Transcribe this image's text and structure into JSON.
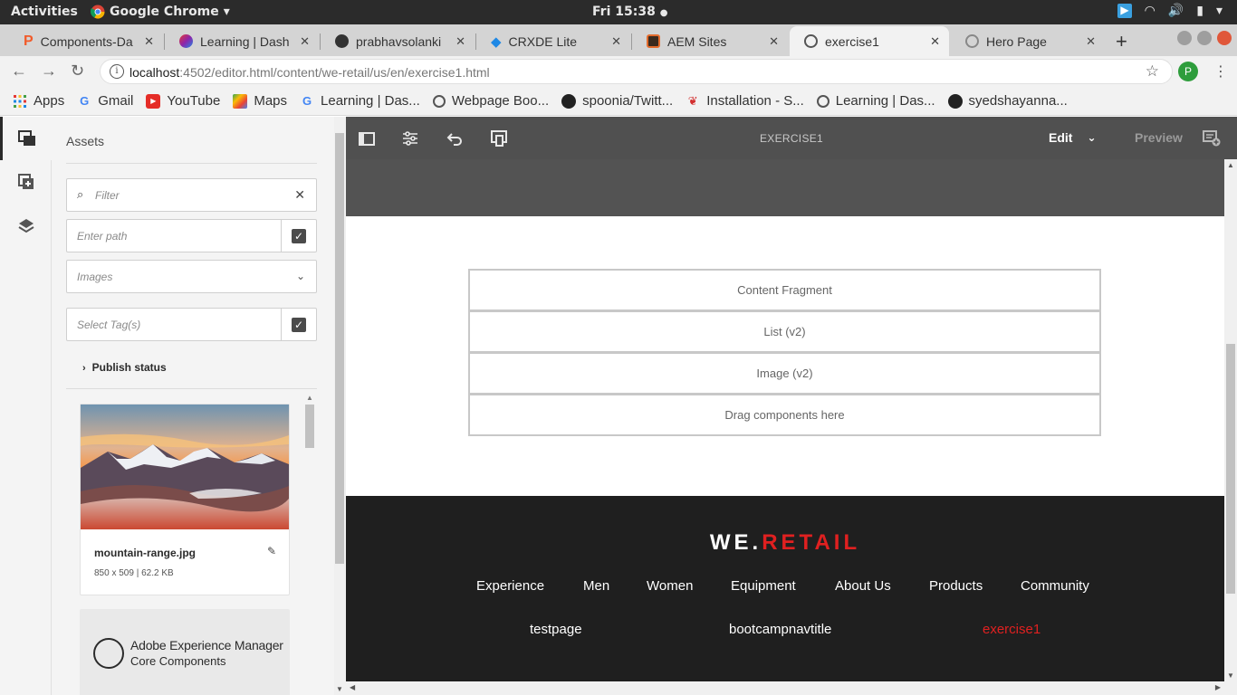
{
  "os": {
    "activities": "Activities",
    "app_name": "Google Chrome",
    "clock": "Fri 15:38"
  },
  "browser": {
    "tabs": [
      {
        "title": "Components-Da",
        "icon": "pluralsight-icon"
      },
      {
        "title": "Learning | Dash",
        "icon": "learning-icon"
      },
      {
        "title": "prabhavsolanki",
        "icon": "github-icon"
      },
      {
        "title": "CRXDE Lite",
        "icon": "crxde-icon"
      },
      {
        "title": "AEM Sites",
        "icon": "aem-icon"
      },
      {
        "title": "exercise1",
        "icon": "globe-icon",
        "active": true
      },
      {
        "title": "Hero Page",
        "icon": "globe-icon"
      }
    ],
    "url_host": "localhost",
    "url_path": ":4502/editor.html/content/we-retail/us/en/exercise1.html",
    "profile_initial": "P",
    "bookmarks": [
      {
        "label": "Apps",
        "icon": "apps-grid-icon"
      },
      {
        "label": "Gmail",
        "icon": "google-icon"
      },
      {
        "label": "YouTube",
        "icon": "youtube-icon"
      },
      {
        "label": "Maps",
        "icon": "maps-icon"
      },
      {
        "label": "Learning | Das...",
        "icon": "google-icon"
      },
      {
        "label": "Webpage Boo...",
        "icon": "globe-icon"
      },
      {
        "label": "spoonia/Twitt...",
        "icon": "github-icon"
      },
      {
        "label": "Installation - S...",
        "icon": "bird-icon"
      },
      {
        "label": "Learning | Das...",
        "icon": "globe-icon"
      },
      {
        "label": "syedshayanna...",
        "icon": "github-icon"
      }
    ]
  },
  "assets_panel": {
    "title": "Assets",
    "filter_placeholder": "Filter",
    "path_placeholder": "Enter path",
    "type_selected": "Images",
    "tags_placeholder": "Select Tag(s)",
    "publish_status": "Publish status",
    "asset": {
      "name": "mountain-range.jpg",
      "meta": "850 x 509 | 62.2 KB"
    },
    "component_card": {
      "line1": "Adobe Experience Manager",
      "line2": "Core Components"
    }
  },
  "editor": {
    "page_title": "EXERCISE1",
    "mode": "Edit",
    "preview": "Preview"
  },
  "page": {
    "placeholders": [
      "Content Fragment",
      "List (v2)",
      "Image (v2)",
      "Drag components here"
    ],
    "brand": {
      "we": "WE",
      "dot": ".",
      "retail": "RETAIL"
    },
    "footer_nav": [
      "Experience",
      "Men",
      "Women",
      "Equipment",
      "About Us",
      "Products",
      "Community"
    ],
    "footer_sub": [
      "testpage",
      "bootcampnavtitle",
      "exercise1"
    ]
  },
  "colors": {
    "accent_red": "#e02020",
    "toolbar": "#505050",
    "footer": "#1f1f1f"
  }
}
